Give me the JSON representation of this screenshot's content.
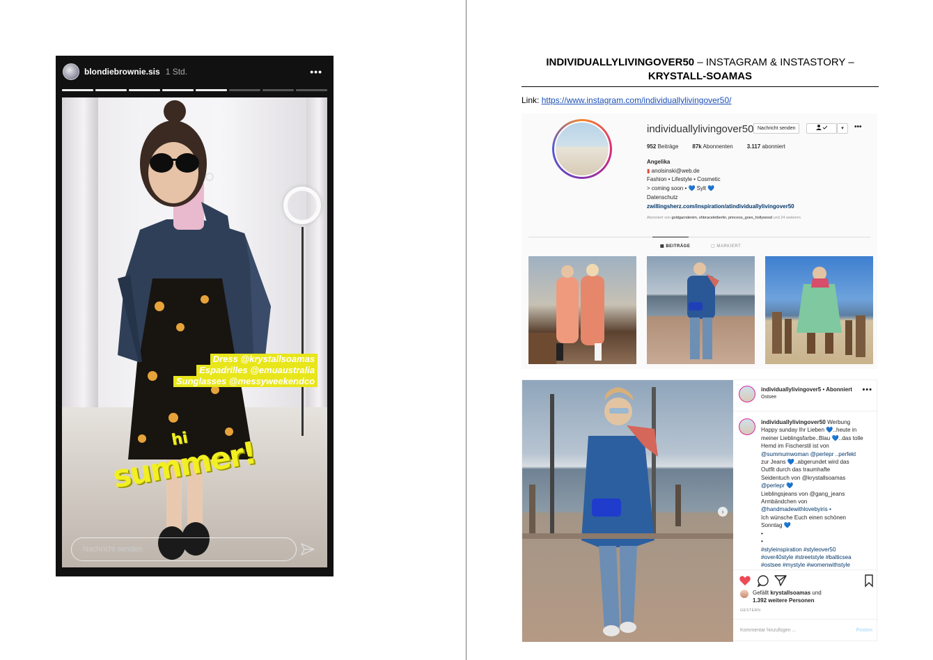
{
  "story": {
    "username": "blondiebrownie.sis",
    "time": "1 Std.",
    "more_icon": "•••",
    "progress_segments_done": 5,
    "progress_segments_total": 8,
    "tags": [
      "Dress @krystallsoamas",
      "Espadrilles @emuaustralia",
      "Sunglasses @messyweekendco"
    ],
    "sticker_small": "hi",
    "sticker_big": "summer!",
    "message_placeholder": "Nachricht senden"
  },
  "doc": {
    "title_bold_1": "INDIVIDUALLYLIVINGOVER50",
    "title_normal": " – INSTAGRAM & INSTASTORY –",
    "title_bold_2": "KRYSTALL-SOAMAS",
    "link_label": "Link: ",
    "link_url": "https://www.instagram.com/individuallylivingover50/"
  },
  "profile": {
    "username": "individuallylivingover50",
    "message_button": "Nachricht senden",
    "follow_button": "▾",
    "more": "•••",
    "posts_count": "952",
    "posts_label": "Beiträge",
    "followers_count": "87k",
    "followers_label": "Abonnenten",
    "following_count": "3.117",
    "following_label": "abonniert",
    "name": "Angelika",
    "email": "anolsinski@web.de",
    "bio_line1": "Fashion • Lifestyle • Cosmetic",
    "bio_line2": "> coming soon • 💙 Sylt 💙",
    "bio_line3": "Datenschutz",
    "website": "zwillingsherz.com/inspiration/atindividuallylivingover50",
    "followed_by_prefix": "Abonniert von ",
    "followed_by_names": "goldgarndenim, ohbraceletberlin, princess_goes_hollywood",
    "followed_by_suffix": " und 24 weiteren",
    "tab_posts": "BEITRÄGE",
    "tab_tagged": "MARKIERT"
  },
  "post": {
    "username": "individuallylivingover5",
    "follow_state": " • Abonniert",
    "location": "Ostsee",
    "more": "•••",
    "caption_user": "individuallylivingover50",
    "caption_lines": [
      " Werbung",
      "Happy sunday Ihr Lieben 💙..heute in",
      "meiner Lieblingsfarbe..Blau 💙..das tolle",
      "Hemd im Fischerstil ist von",
      "@summumwoman @perlepr ..perfekt",
      "zur Jeans 💙..abgerundet wird das",
      "Outfit durch das traumhafte",
      "Seidentuch von @krystallsoamas",
      "@perlepr 💙",
      "Lieblingsjeans von @gang_jeans",
      "Armbändchen von",
      "@handmadewithlovebyiris •",
      "Ich wünsche Euch einen schönen",
      "Sonntag 💙",
      "•",
      "•",
      "#styleinspiration #styleover50",
      "#over40style #streetstyle #balticsea",
      "#ostsee #mystyle #womenwithstyle"
    ],
    "likes_prefix": "Gefällt ",
    "likes_user": "krystallsoamas",
    "likes_suffix": " und",
    "likes_others": "1.392 weitere Personen",
    "date": "GESTERN",
    "comment_placeholder": "Kommentar hinzufügen ...",
    "post_button": "Posten",
    "carousel_arrow": "›"
  },
  "colors": {
    "like_red": "#ed4956",
    "tag_yellow": "#e8e61a",
    "link_blue": "#1a4fb5"
  }
}
